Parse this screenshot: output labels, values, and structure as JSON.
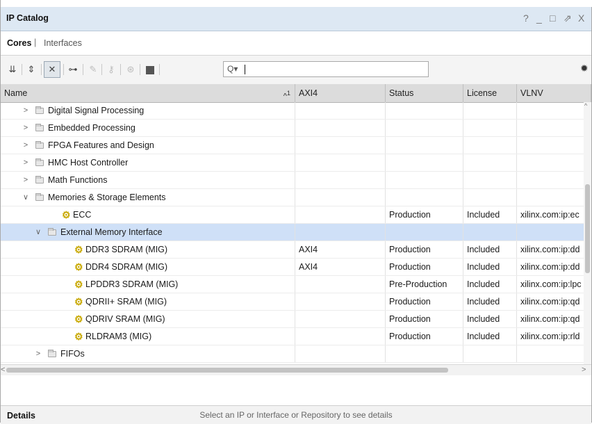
{
  "window": {
    "title": "IP Catalog",
    "controls": [
      "?",
      "_",
      "□",
      "⇗",
      "X"
    ]
  },
  "tabs": [
    {
      "label": "Cores",
      "active": true
    },
    {
      "label": "Interfaces",
      "active": false
    }
  ],
  "tab_separator": "|",
  "toolbar": {
    "search": {
      "value": "",
      "placeholder": ""
    }
  },
  "columns": [
    {
      "label": "Name",
      "sort": "1"
    },
    {
      "label": "AXI4"
    },
    {
      "label": "Status"
    },
    {
      "label": "License"
    },
    {
      "label": "VLNV"
    }
  ],
  "rows": [
    {
      "name": "Digital Signal Processing",
      "type": "folder",
      "expanded": false
    },
    {
      "name": "Embedded Processing",
      "type": "folder",
      "expanded": false
    },
    {
      "name": "FPGA Features and Design",
      "type": "folder",
      "expanded": false
    },
    {
      "name": "HMC Host Controller",
      "type": "folder",
      "expanded": false
    },
    {
      "name": "Math Functions",
      "type": "folder",
      "expanded": false
    },
    {
      "name": "Memories & Storage Elements",
      "type": "folder",
      "expanded": true
    },
    {
      "name": "ECC",
      "type": "ip",
      "axi4": "",
      "status": "Production",
      "license": "Included",
      "vlnv": "xilinx.com:ip:ec"
    },
    {
      "name": "External Memory Interface",
      "type": "folder",
      "expanded": true,
      "selected": true
    },
    {
      "name": "DDR3 SDRAM (MIG)",
      "type": "ip",
      "axi4": "AXI4",
      "status": "Production",
      "license": "Included",
      "vlnv": "xilinx.com:ip:dd"
    },
    {
      "name": "DDR4 SDRAM (MIG)",
      "type": "ip",
      "axi4": "AXI4",
      "status": "Production",
      "license": "Included",
      "vlnv": "xilinx.com:ip:dd"
    },
    {
      "name": "LPDDR3 SDRAM (MIG)",
      "type": "ip",
      "axi4": "",
      "status": "Pre-Production",
      "license": "Included",
      "vlnv": "xilinx.com:ip:lpc"
    },
    {
      "name": "QDRII+ SRAM (MIG)",
      "type": "ip",
      "axi4": "",
      "status": "Production",
      "license": "Included",
      "vlnv": "xilinx.com:ip:qd"
    },
    {
      "name": "QDRIV SRAM (MIG)",
      "type": "ip",
      "axi4": "",
      "status": "Production",
      "license": "Included",
      "vlnv": "xilinx.com:ip:qd"
    },
    {
      "name": "RLDRAM3 (MIG)",
      "type": "ip",
      "axi4": "",
      "status": "Production",
      "license": "Included",
      "vlnv": "xilinx.com:ip:rld"
    },
    {
      "name": "FIFOs",
      "type": "folder",
      "expanded": false
    }
  ],
  "details": {
    "title": "Details",
    "hint": "Select an IP or Interface or Repository to see details"
  }
}
